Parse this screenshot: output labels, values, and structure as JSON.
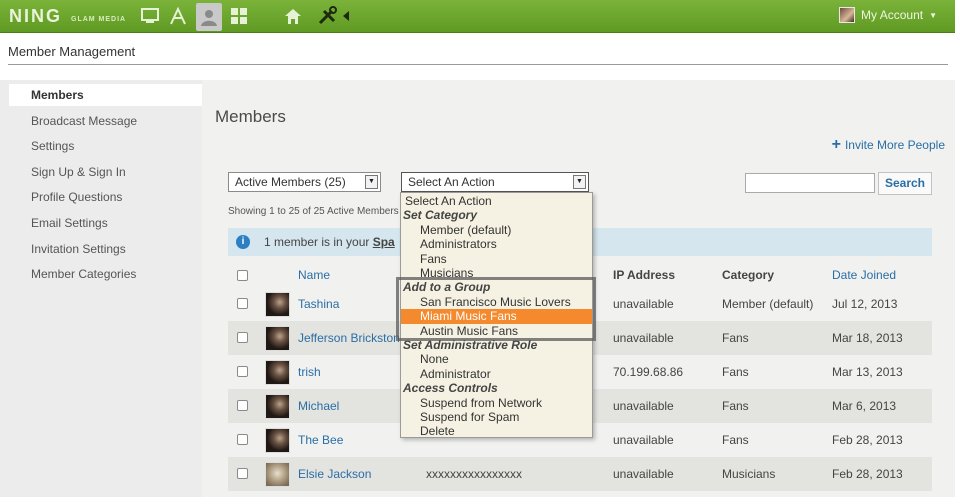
{
  "topbar": {
    "logo": "NING",
    "logo_sub": "GLAM MEDIA",
    "account_label": "My Account",
    "colors": {
      "bar": "#6aa52b",
      "selected_option": "#f4892d",
      "link": "#2a6ea6"
    }
  },
  "subheader": {
    "title": "Member Management"
  },
  "sidebar": {
    "items": [
      {
        "label": "Members"
      },
      {
        "label": "Broadcast Message"
      },
      {
        "label": "Settings"
      },
      {
        "label": "Sign Up & Sign In"
      },
      {
        "label": "Profile Questions"
      },
      {
        "label": "Email Settings"
      },
      {
        "label": "Invitation Settings"
      },
      {
        "label": "Member Categories"
      }
    ]
  },
  "main": {
    "title": "Members",
    "invite_label": "Invite More People",
    "filter_select_value": "Active Members (25)",
    "action_select_value": "Select An Action",
    "search_button": "Search",
    "showing_text": "Showing 1 to 25 of 25 Active Members",
    "notice": {
      "text": "1 member is in your ",
      "link": "Spa"
    },
    "columns": {
      "name": "Name",
      "ip": "IP Address",
      "category": "Category",
      "date": "Date Joined"
    },
    "rows": [
      {
        "name": "Tashina",
        "ip": "unavailable",
        "category": "Member (default)",
        "date": "Jul 12, 2013"
      },
      {
        "name": "Jefferson Brickstone",
        "ip": "unavailable",
        "category": "Fans",
        "date": "Mar 18, 2013"
      },
      {
        "name": "trish",
        "ip": "70.199.68.86",
        "category": "Fans",
        "date": "Mar 13, 2013"
      },
      {
        "name": "Michael",
        "ip": "unavailable",
        "category": "Fans",
        "date": "Mar 6, 2013"
      },
      {
        "name": "The Bee",
        "ip": "unavailable",
        "category": "Fans",
        "date": "Feb 28, 2013"
      },
      {
        "name": "Elsie Jackson",
        "email": "xxxxxxxxxxxxxxxx",
        "ip": "unavailable",
        "category": "Musicians",
        "date": "Feb 28, 2013"
      }
    ]
  },
  "dropdown": {
    "items": [
      {
        "label": "Select An Action",
        "kind": "first"
      },
      {
        "label": "Set Category",
        "kind": "group"
      },
      {
        "label": "Member (default)",
        "kind": "option"
      },
      {
        "label": "Administrators",
        "kind": "option"
      },
      {
        "label": "Fans",
        "kind": "option"
      },
      {
        "label": "Musicians",
        "kind": "option"
      },
      {
        "label": "Add to a Group",
        "kind": "group"
      },
      {
        "label": "San Francisco Music Lovers",
        "kind": "option"
      },
      {
        "label": "Miami Music Fans",
        "kind": "option",
        "selected": true
      },
      {
        "label": "Austin Music Fans",
        "kind": "option"
      },
      {
        "label": "Set Administrative Role",
        "kind": "group"
      },
      {
        "label": "None",
        "kind": "option"
      },
      {
        "label": "Administrator",
        "kind": "option"
      },
      {
        "label": "Access Controls",
        "kind": "group"
      },
      {
        "label": "Suspend from Network",
        "kind": "option"
      },
      {
        "label": "Suspend for Spam",
        "kind": "option"
      },
      {
        "label": "Delete",
        "kind": "option"
      }
    ]
  }
}
